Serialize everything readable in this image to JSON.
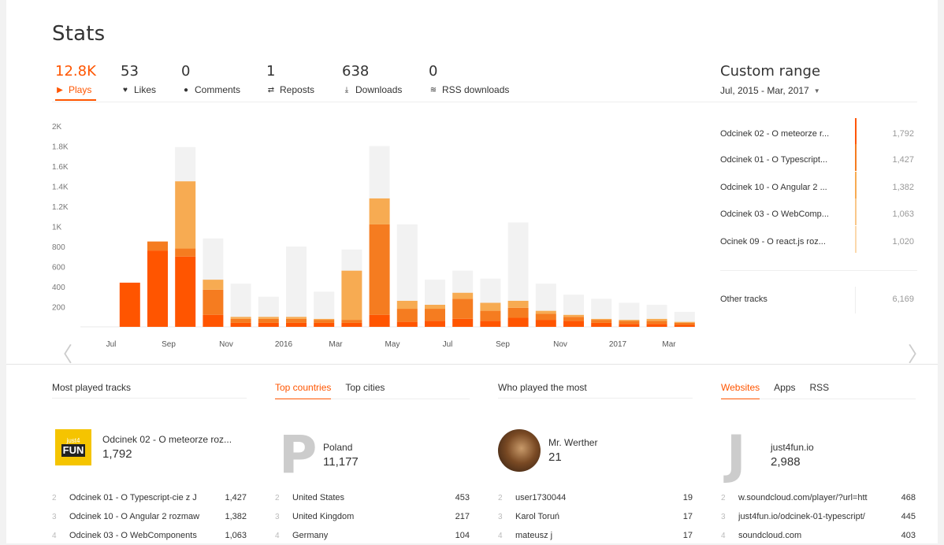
{
  "page_title": "Stats",
  "metrics": [
    {
      "value": "12.8K",
      "label": "Plays",
      "icon": "play-icon",
      "active": true
    },
    {
      "value": "53",
      "label": "Likes",
      "icon": "heart-icon"
    },
    {
      "value": "0",
      "label": "Comments",
      "icon": "comment-icon"
    },
    {
      "value": "1",
      "label": "Reposts",
      "icon": "repost-icon"
    },
    {
      "value": "638",
      "label": "Downloads",
      "icon": "download-icon"
    },
    {
      "value": "0",
      "label": "RSS downloads",
      "icon": "rss-icon"
    }
  ],
  "range": {
    "title": "Custom range",
    "value": "Jul, 2015 - Mar, 2017"
  },
  "colors": {
    "accent": "#ff5500",
    "dark": "#ff5500",
    "mid": "#f57c20",
    "light": "#f7ab52",
    "ghost": "#f2f2f2"
  },
  "chart_data": {
    "type": "bar",
    "stacked": true,
    "y_ticks": [
      "2K",
      "1.8K",
      "1.6K",
      "1.4K",
      "1.2K",
      "1K",
      "800",
      "600",
      "400",
      "200"
    ],
    "ylim": [
      0,
      2000
    ],
    "x_tick_labels": [
      "Jul",
      "Sep",
      "Nov",
      "2016",
      "Mar",
      "May",
      "Jul",
      "Sep",
      "Nov",
      "2017",
      "Mar"
    ],
    "series": [
      {
        "values": [
          0,
          440,
          760,
          700,
          120,
          40,
          40,
          40,
          40,
          40,
          120,
          50,
          60,
          80,
          60,
          90,
          70,
          60,
          40,
          30,
          30,
          20
        ]
      },
      {
        "values": [
          0,
          0,
          90,
          80,
          250,
          40,
          40,
          40,
          30,
          30,
          900,
          130,
          120,
          200,
          100,
          100,
          60,
          40,
          30,
          30,
          30,
          20
        ]
      },
      {
        "values": [
          0,
          0,
          0,
          670,
          100,
          20,
          20,
          20,
          10,
          490,
          260,
          80,
          40,
          60,
          80,
          70,
          30,
          20,
          10,
          10,
          20,
          10
        ]
      },
      {
        "values": [
          0,
          0,
          0,
          340,
          410,
          330,
          200,
          700,
          270,
          210,
          520,
          760,
          250,
          220,
          240,
          780,
          270,
          200,
          200,
          170,
          140,
          100
        ]
      }
    ]
  },
  "top_tracks": [
    {
      "name": "Odcinek 02 - O meteorze r...",
      "value": "1,792"
    },
    {
      "name": "Odcinek 01 - O Typescript...",
      "value": "1,427"
    },
    {
      "name": "Odcinek 10 - O Angular 2 ...",
      "value": "1,382"
    },
    {
      "name": "Odcinek 03 - O WebComp...",
      "value": "1,063"
    },
    {
      "name": "Ocinek 09 - O react.js roz...",
      "value": "1,020"
    }
  ],
  "other_tracks": {
    "label": "Other tracks",
    "value": "6,169"
  },
  "sections": {
    "most_played": {
      "header": "Most played tracks",
      "logo_text_top": "just4",
      "logo_text": "FUN",
      "top_name": "Odcinek 02 - O meteorze roz...",
      "top_value": "1,792",
      "rows": [
        {
          "idx": "2",
          "name": "Odcinek 01 - O Typescript-cie z J",
          "value": "1,427"
        },
        {
          "idx": "3",
          "name": "Odcinek 10 - O Angular 2 rozmaw",
          "value": "1,382"
        },
        {
          "idx": "4",
          "name": "Odcinek 03 - O WebComponents",
          "value": "1,063"
        }
      ]
    },
    "countries": {
      "tab1": "Top countries",
      "tab2": "Top cities",
      "letter": "P",
      "top_name": "Poland",
      "top_value": "11,177",
      "rows": [
        {
          "idx": "2",
          "name": "United States",
          "value": "453"
        },
        {
          "idx": "3",
          "name": "United Kingdom",
          "value": "217"
        },
        {
          "idx": "4",
          "name": "Germany",
          "value": "104"
        }
      ]
    },
    "listeners": {
      "header": "Who played the most",
      "top_name": "Mr. Werther",
      "top_value": "21",
      "rows": [
        {
          "idx": "2",
          "name": "user1730044",
          "value": "19"
        },
        {
          "idx": "3",
          "name": "Karol Toruń",
          "value": "17"
        },
        {
          "idx": "4",
          "name": "mateusz j",
          "value": "17"
        }
      ]
    },
    "websites": {
      "tab1": "Websites",
      "tab2": "Apps",
      "tab3": "RSS",
      "letter": "J",
      "top_name": "just4fun.io",
      "top_value": "2,988",
      "rows": [
        {
          "idx": "2",
          "name": "w.soundcloud.com/player/?url=htt",
          "value": "468"
        },
        {
          "idx": "3",
          "name": "just4fun.io/odcinek-01-typescript/",
          "value": "445"
        },
        {
          "idx": "4",
          "name": "soundcloud.com",
          "value": "403"
        }
      ]
    }
  }
}
